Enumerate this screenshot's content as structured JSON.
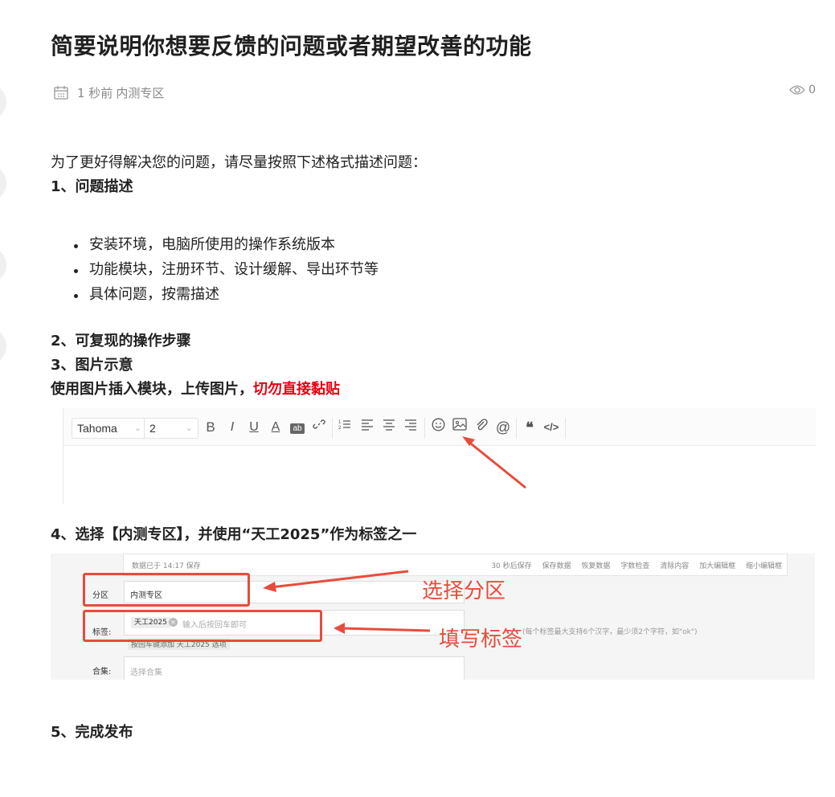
{
  "post": {
    "title": "简要说明你想要反馈的问题或者期望改善的功能",
    "time": "1 秒前",
    "zone": "内测专区",
    "views": "0"
  },
  "body": {
    "intro": "为了更好得解决您的问题，请尽量按照下述格式描述问题：",
    "step1": "1、问题描述",
    "bullets": [
      "安装环境，电脑所使用的操作系统版本",
      "功能模块，注册环节、设计缓解、导出环节等",
      "具体问题，按需描述"
    ],
    "step2": "2、可复现的操作步骤",
    "step3": "3、图片示意",
    "step3_note": "使用图片插入模块，上传图片，",
    "step3_warn": "切勿直接黏贴",
    "step4": "4、选择【内测专区】，并使用“天工2025”作为标签之一",
    "step5": "5、完成发布"
  },
  "editor_toolbar": {
    "font": "Tahoma",
    "size": "2",
    "bold": "B",
    "italic": "I",
    "underline": "U",
    "font_color": "A",
    "bg_color": "ab",
    "indent": "§",
    "quote": "❝",
    "code": "</>"
  },
  "form_shot": {
    "saved": "数据已于 14:17 保存",
    "autosave": "30 秒后保存",
    "actions": [
      "保存数据",
      "恢复数据",
      "字数检查",
      "清除内容",
      "加大编辑框",
      "缩小编辑框"
    ],
    "zone_label": "分区",
    "zone_value": "内测专区",
    "tags_label": "标签:",
    "tag": "天工2025",
    "tag_placeholder": "输入后按回车即可",
    "tag_hint": "(每个标签最大支持6个汉字，最少须2个字符，如\"ok\")",
    "tag_suggest": "按回车键添加 天工2025 选项",
    "collection_label": "合集:",
    "collection_placeholder": "选择合集",
    "annot_zone": "选择分区",
    "annot_tag": "填写标签"
  },
  "colors": {
    "warn": "#e60012",
    "annotation": "#e74c3c"
  }
}
